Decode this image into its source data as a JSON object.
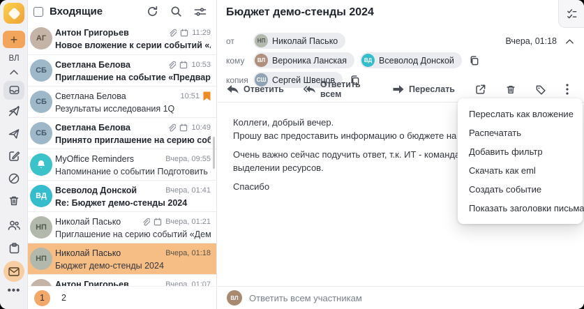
{
  "accent_colors": {
    "orange_accent": "#f2a45c",
    "selected_row": "#f6bd85",
    "flag": "#ef8b23",
    "teal_avatar": "#35bccd",
    "page_active": "#f2a869"
  },
  "rail": {
    "user_initials": "ВЛ",
    "compose_label": "+",
    "items": [
      "collapse-chevron",
      "inbox",
      "outbox",
      "sent",
      "drafts",
      "spam",
      "trash"
    ],
    "bottom_items": [
      "contacts",
      "calendar",
      "mail",
      "more"
    ]
  },
  "icons": {
    "refresh": "⟳",
    "search": "⌕",
    "filter": "≑",
    "attachment": "📎",
    "event": "🗓",
    "flag": "🔖",
    "reply": "↩",
    "reply_all": "↩↩",
    "forward": "➡",
    "open_in_new": "🡵",
    "delete": "🗑",
    "tag": "🏷",
    "more": "⋮",
    "copy": "⧉",
    "collapse": "⌃",
    "tasks": "☑",
    "bell": "🔔"
  },
  "list": {
    "title": "Входящие",
    "rows": [
      {
        "name": "Антон Григорьев",
        "initials": "АГ",
        "subject": "Новое вложение к серии событий «Аналити...",
        "time": "11:29",
        "meta_icons": [
          "attachment",
          "event"
        ],
        "unread": true
      },
      {
        "name": "Светлана Белова",
        "initials": "СБ",
        "subject": "Приглашение на событие «Предварительно...",
        "time": "10:53",
        "meta_icons": [
          "attachment",
          "event"
        ],
        "unread": true
      },
      {
        "name": "Светлана Белова",
        "initials": "СБ",
        "subject": "Результаты исследования 1Q",
        "time": "10:51",
        "meta_icons": [
          "flag"
        ],
        "unread": false
      },
      {
        "name": "Светлана Белова",
        "initials": "СБ",
        "subject": "Принято приглашение на серию событий «...",
        "time": "10:49",
        "meta_icons": [
          "attachment",
          "event"
        ],
        "unread": true
      },
      {
        "name": "MyOffice Reminders",
        "initials": "",
        "subject": "Напоминание о событии Подготовить отчет...",
        "time": "Вчера, 09:55",
        "meta_icons": [],
        "unread": false
      },
      {
        "name": "Всеволод Донской",
        "initials": "ВД",
        "subject": "Re: Бюджет демо-стенды 2024",
        "time": "Вчера, 01:41",
        "meta_icons": [],
        "unread": true
      },
      {
        "name": "Николай Пасько",
        "initials": "НП",
        "subject": "Приглашение на серию событий «Демо стен...",
        "time": "Вчера, 01:21",
        "meta_icons": [
          "attachment",
          "event"
        ],
        "unread": false
      },
      {
        "name": "Николай Пасько",
        "initials": "НП",
        "subject": "Бюджет демо-стенды 2024",
        "time": "Вчера, 01:18",
        "meta_icons": [],
        "unread": false,
        "selected": true
      },
      {
        "name": "Антон Григорьев",
        "initials": "АГ",
        "subject": "",
        "time": "Вчера, 01:07",
        "meta_icons": [],
        "unread": true
      }
    ],
    "pagination": {
      "pages": [
        "1",
        "2"
      ],
      "active": "1"
    }
  },
  "message": {
    "title": "Бюджет демо-стенды 2024",
    "date": "Вчера, 01:18",
    "from_label": "от",
    "from": {
      "name": "Николай Пасько",
      "initials": "НП"
    },
    "to_label": "кому",
    "to": [
      {
        "name": "Вероника Ланская",
        "initials": "ВЛ"
      },
      {
        "name": "Всеволод Донской",
        "initials": "ВД"
      }
    ],
    "cc_label": "копия",
    "cc": [
      {
        "name": "Сергей Швецов",
        "initials": "СШ"
      }
    ],
    "actions": {
      "reply": "Ответить",
      "reply_all": "Ответить всем",
      "forward": "Переслать"
    },
    "body": {
      "l1": "Коллеги, добрый вечер.",
      "l2": "Прошу вас предоставить информацию о бюджете на наши демонстраци",
      "l3": "Очень важно сейчас подучить ответ, т.к. ИТ - команда Всеволода, уже",
      "l4": "выделении ресурсов.",
      "l5": "Спасибо"
    },
    "quick_reply": "Ответить всем участникам"
  },
  "context_menu": {
    "items": [
      {
        "label": "Переслать как вложение"
      },
      {
        "label": "Распечатать"
      },
      {
        "label": "Добавить фильтр"
      },
      {
        "label": "Скачать как eml"
      },
      {
        "label": "Создать событие"
      },
      {
        "label": "Показать заголовки письма"
      }
    ]
  }
}
